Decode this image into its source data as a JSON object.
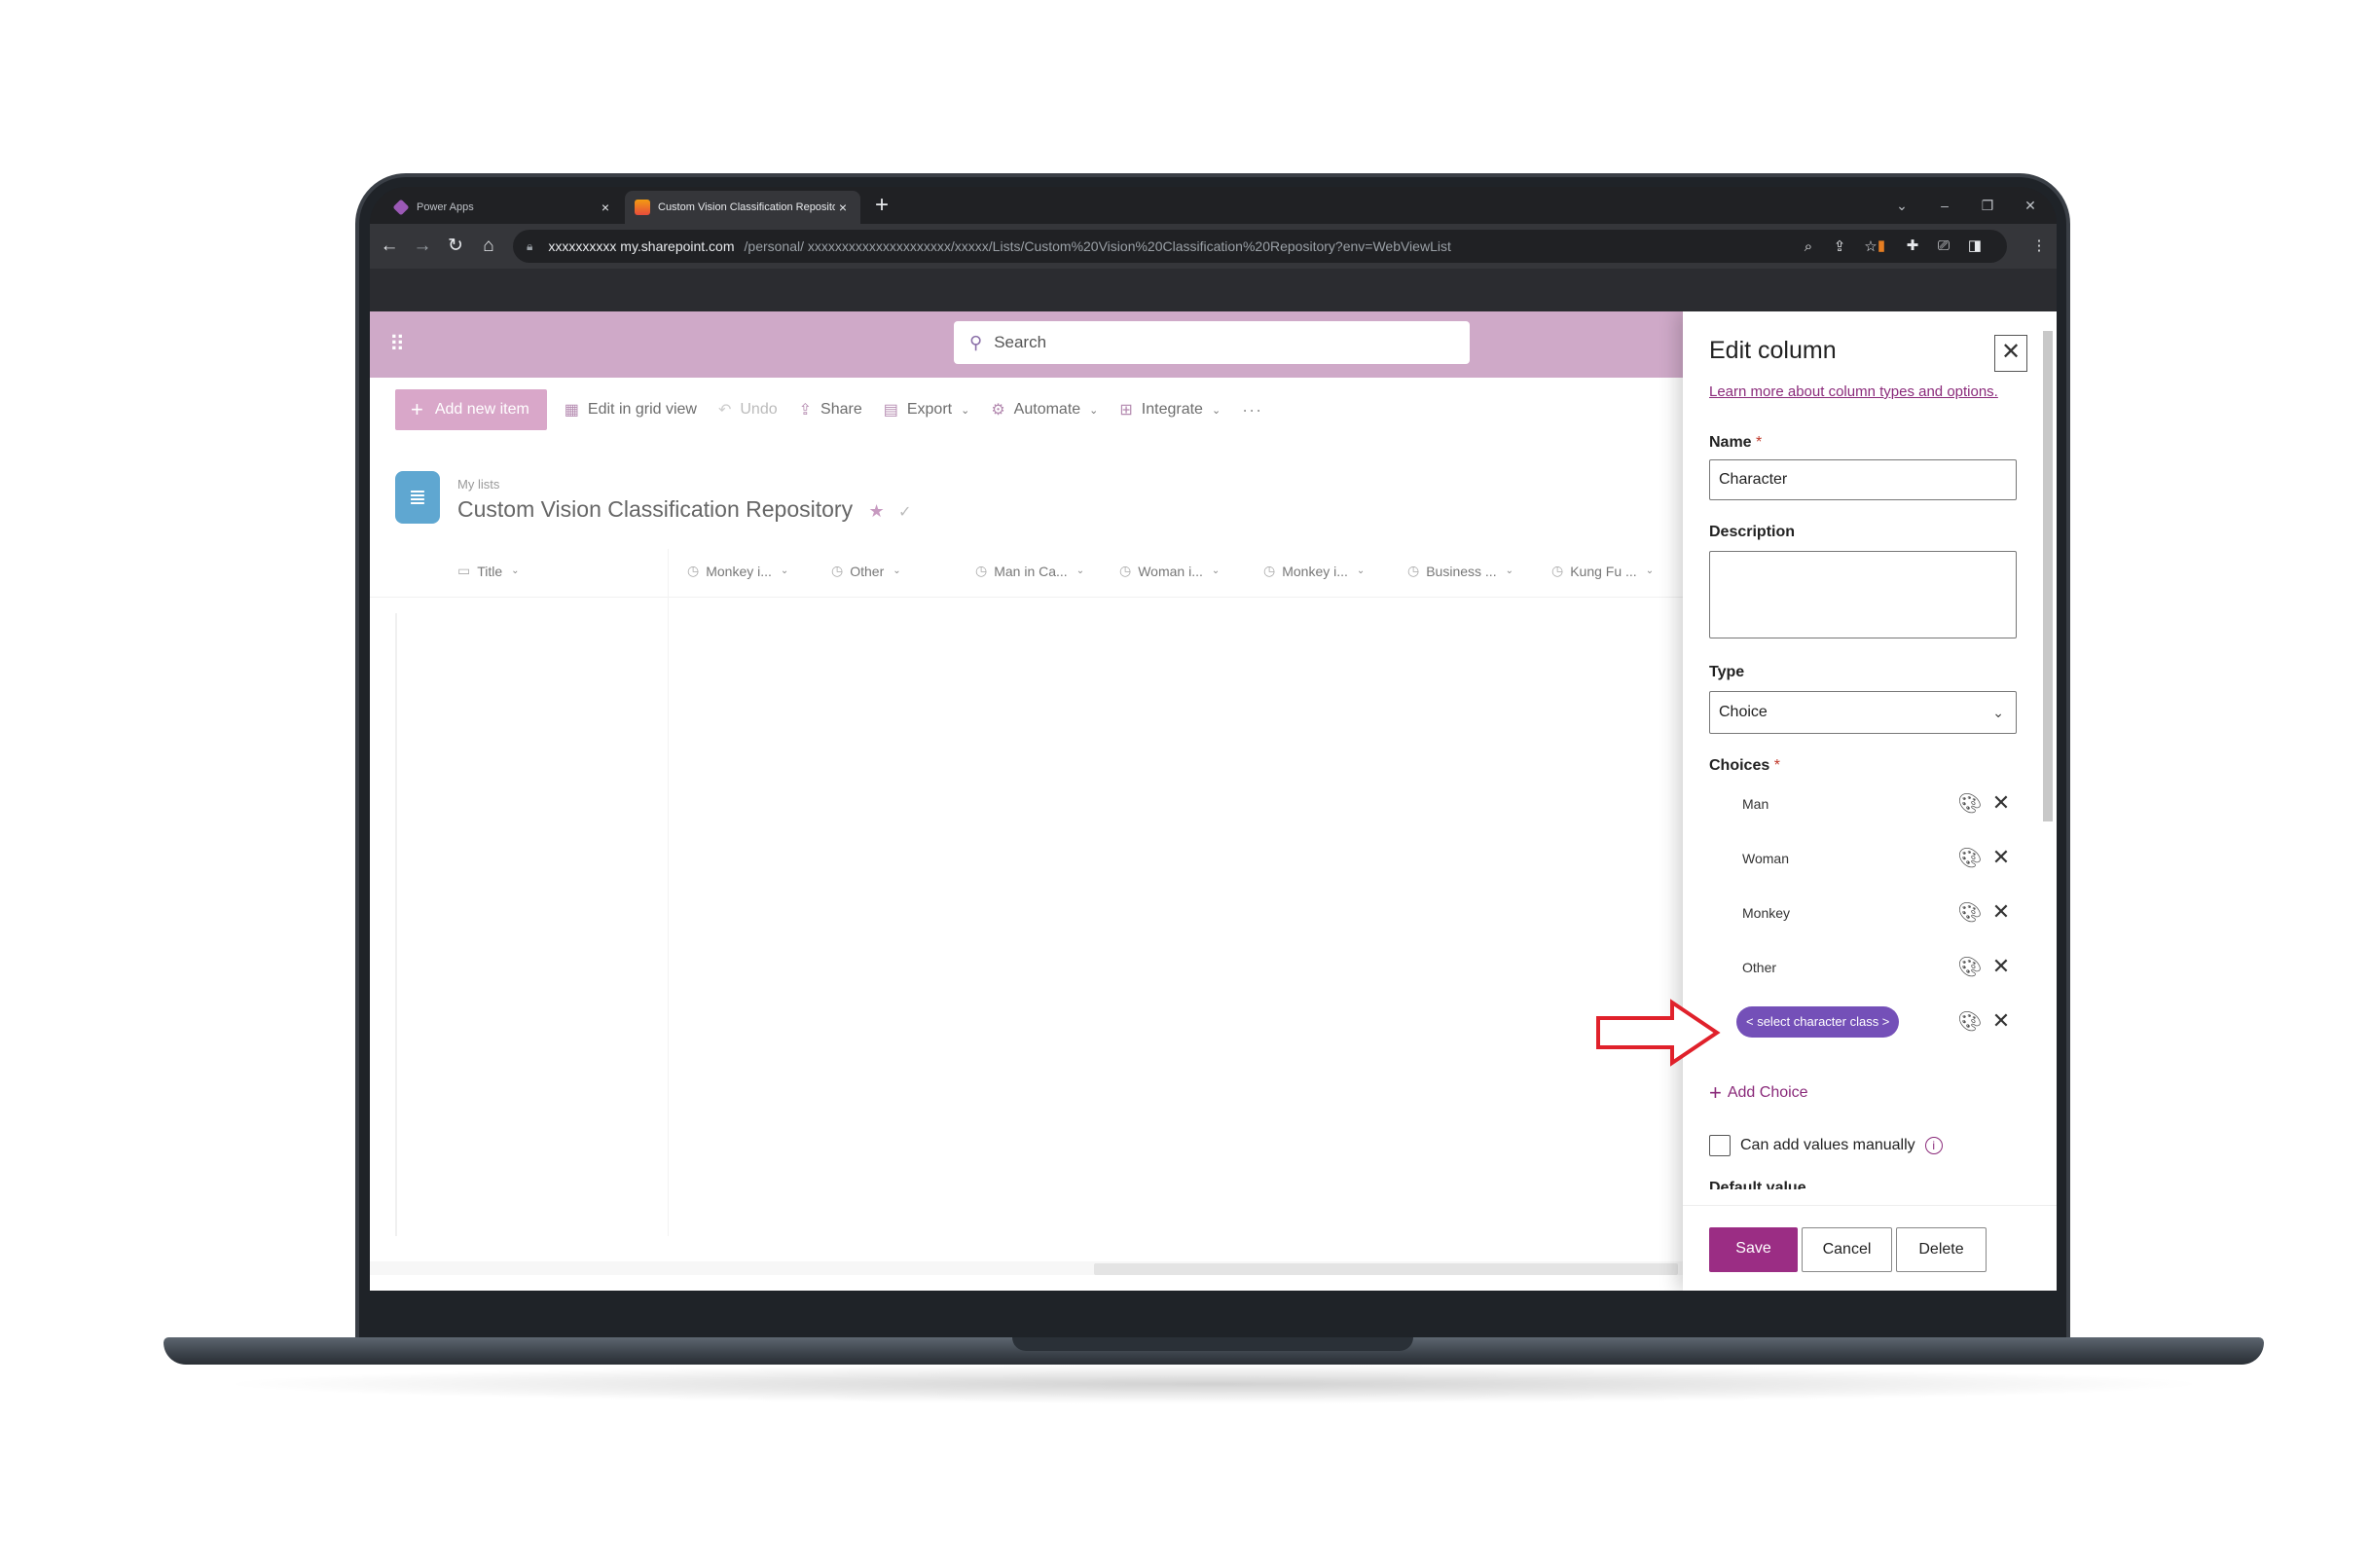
{
  "browser": {
    "tabs": [
      {
        "title": "Power Apps",
        "active": false,
        "favicon_color": "#9b59b6"
      },
      {
        "title": "Custom Vision Classification Repository",
        "active": true,
        "favicon_color": "#e67e22"
      }
    ],
    "tab_close_glyph": "×",
    "new_tab_glyph": "+",
    "url_host": "xxxxxxxxxx  my.sharepoint.com",
    "url_path": "/personal/ xxxxxxxxxxxxxxxxxxxxx/xxxxx/Lists/Custom%20Vision%20Classification%20Repository?env=WebViewList"
  },
  "suitebar": {
    "search_placeholder": "Search"
  },
  "commands": {
    "add_new_item": "Add new item",
    "edit_grid": "Edit in grid view",
    "undo": "Undo",
    "share": "Share",
    "export": "Export",
    "automate": "Automate",
    "integrate": "Integrate",
    "more": "···"
  },
  "list": {
    "breadcrumb": "My lists",
    "title": "Custom Vision Classification Repository",
    "columns": [
      "Title",
      "Monkey i...",
      "Other",
      "Man in Ca...",
      "Woman i...",
      "Monkey i...",
      "Business ...",
      "Kung Fu ..."
    ]
  },
  "panel": {
    "title": "Edit column",
    "learn_link": "Learn more about column types and options.",
    "name_label": "Name",
    "name_value": "Character",
    "description_label": "Description",
    "type_label": "Type",
    "type_value": "Choice",
    "choices_label": "Choices",
    "required_mark": "*",
    "choices": [
      "Man",
      "Woman",
      "Monkey",
      "Other"
    ],
    "new_choice_pill": "< select character class >",
    "add_choice": "Add Choice",
    "manual_values_label": "Can add values manually",
    "default_value_label": "Default value",
    "save": "Save",
    "cancel": "Cancel",
    "delete": "Delete"
  },
  "colors": {
    "suitebar": "#cfa9c8",
    "accent": "#9b2d84",
    "pill": "#7450b8",
    "annotation_arrow": "#e0212b"
  }
}
